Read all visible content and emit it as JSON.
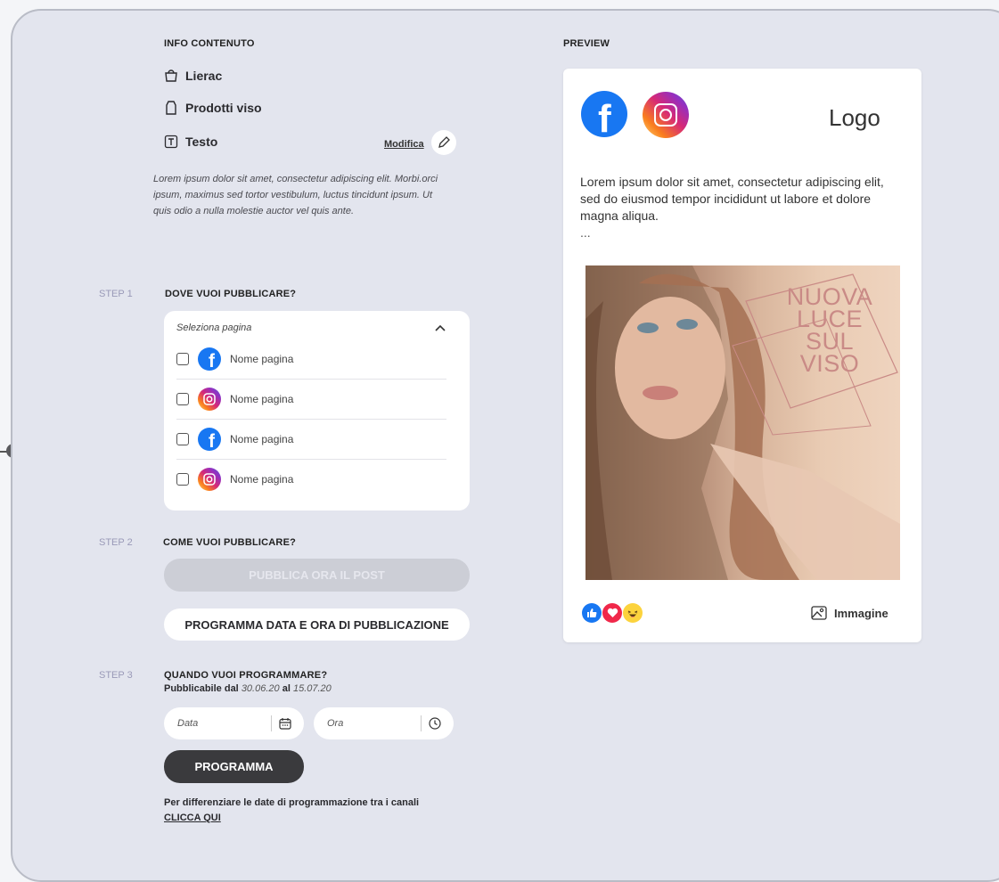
{
  "info": {
    "title": "INFO CONTENUTO",
    "brand": "Lierac",
    "category": "Prodotti viso",
    "type": "Testo",
    "edit_label": "Modifica",
    "description": "Lorem ipsum dolor sit amet, consectetur adipiscing elit. Morbi.orci ipsum, maximus sed tortor vestibulum, luctus tincidunt ipsum. Ut quis odio a nulla molestie auctor vel quis ante."
  },
  "step1": {
    "label": "STEP 1",
    "title": "DOVE VUOI PUBBLICARE?",
    "select_placeholder": "Seleziona pagina",
    "pages": [
      {
        "network": "facebook",
        "name": "Nome pagina"
      },
      {
        "network": "instagram",
        "name": "Nome pagina"
      },
      {
        "network": "facebook",
        "name": "Nome pagina"
      },
      {
        "network": "instagram",
        "name": "Nome pagina"
      }
    ]
  },
  "step2": {
    "label": "STEP 2",
    "title": "COME VUOI PUBBLICARE?",
    "publish_now": "PUBBLICA ORA IL POST",
    "schedule": "PROGRAMMA DATA E ORA DI PUBBLICAZIONE"
  },
  "step3": {
    "label": "STEP 3",
    "title": "QUANDO VUOI PROGRAMMARE?",
    "available_prefix": "Pubblicabile dal",
    "date_from": "30.06.20",
    "available_mid": "al",
    "date_to": "15.07.20",
    "date_placeholder": "Data",
    "time_placeholder": "Ora",
    "program_button": "PROGRAMMA",
    "note": "Per differenziare le date di  programmazione tra i canali",
    "click_here": "CLICCA QUI"
  },
  "preview": {
    "title": "PREVIEW",
    "logo": "Logo",
    "text": "Lorem ipsum dolor sit amet, consectetur adipiscing elit, sed do eiusmod tempor incididunt ut labore et dolore magna aliqua.",
    "ellipsis": "...",
    "image_title": [
      "NUOVA",
      "LUCE",
      "SUL",
      "VISO"
    ],
    "image_label": "Immagine"
  },
  "colors": {
    "facebook": "#1877f2",
    "instagram_gradient": [
      "#feda75",
      "#fa7e1e",
      "#d62976",
      "#962fbf",
      "#4f5bd5"
    ],
    "panel_bg": "#e3e5ee",
    "dark_button": "#3a3a3d"
  }
}
